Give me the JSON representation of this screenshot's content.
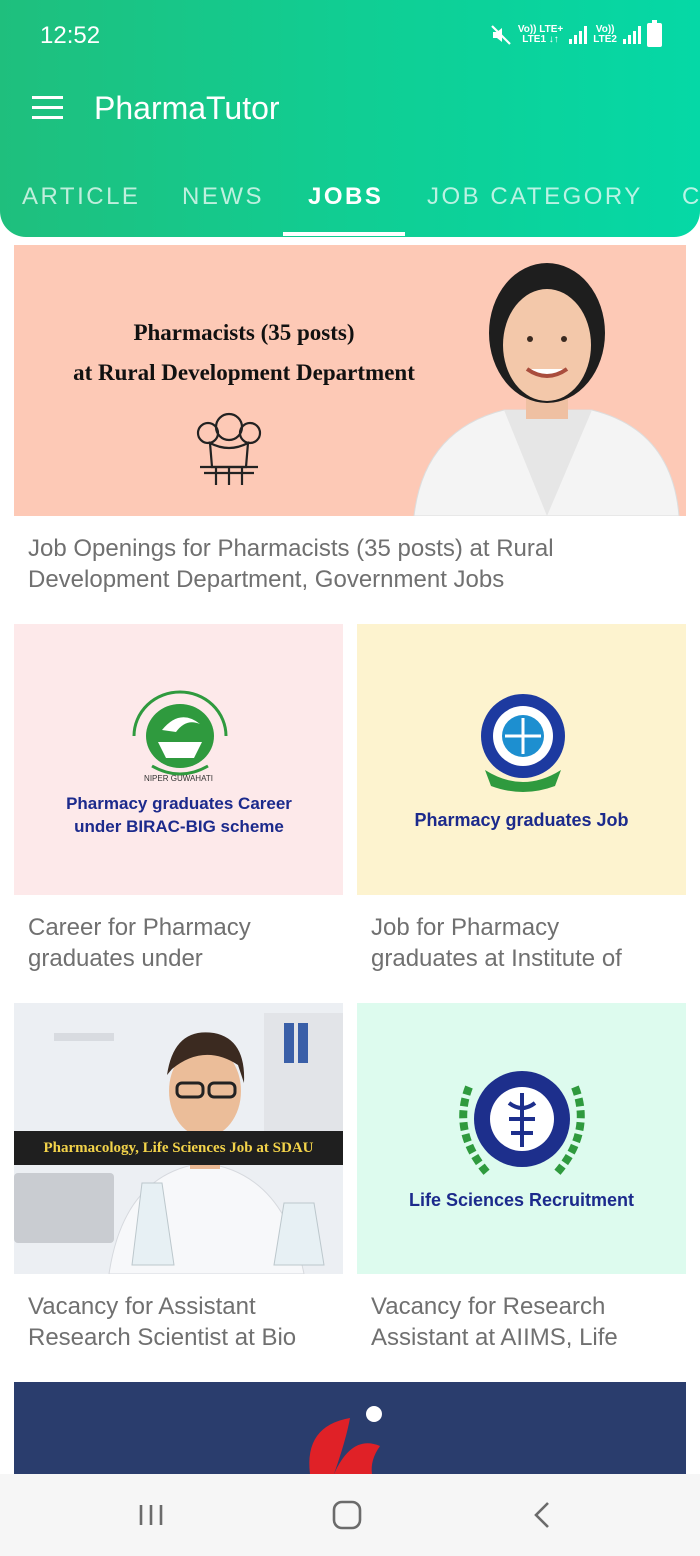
{
  "status_bar": {
    "time": "12:52",
    "sim1_top": "Vo)) LTE+",
    "sim1_bottom": "LTE1 ↓↑",
    "sim2_top": "Vo))",
    "sim2_bottom": "LTE2"
  },
  "app_bar": {
    "title": "PharmaTutor"
  },
  "tabs": [
    {
      "label": "ARTICLE",
      "active": false
    },
    {
      "label": "NEWS",
      "active": false
    },
    {
      "label": "JOBS",
      "active": true
    },
    {
      "label": "JOB CATEGORY",
      "active": false
    },
    {
      "label": "C",
      "active": false
    }
  ],
  "featured": {
    "image_line1": "Pharmacists (35 posts)",
    "image_line2": "at Rural Development Department",
    "caption": "Job Openings for Pharmacists (35 posts) at Rural Development Department, Government Jobs"
  },
  "grid": [
    {
      "image_text": "Pharmacy graduates Career under BIRAC-BIG scheme",
      "logo_text": "NIPER GUWAHATI",
      "caption": "Career for Pharmacy graduates under"
    },
    {
      "image_text": "Pharmacy graduates Job",
      "caption": "Job for Pharmacy graduates at Institute of"
    },
    {
      "image_text": "Pharmacology, Life Sciences Job at SDAU",
      "caption": "Vacancy for Assistant Research Scientist at Bio"
    },
    {
      "image_text": "Life Sciences Recruitment",
      "caption": "Vacancy for Research Assistant at AIIMS, Life"
    }
  ],
  "colors": {
    "app_bar_start": "#1fbf7d",
    "app_bar_end": "#05d8a6",
    "featured_bg": "#fdc9b6",
    "card1_bg": "#fde9ea",
    "card2_bg": "#fdf3cf",
    "card4_bg": "#ddfbee",
    "bottom_card_bg": "#2a3d6d",
    "headline_blue": "#1c2a8c"
  }
}
